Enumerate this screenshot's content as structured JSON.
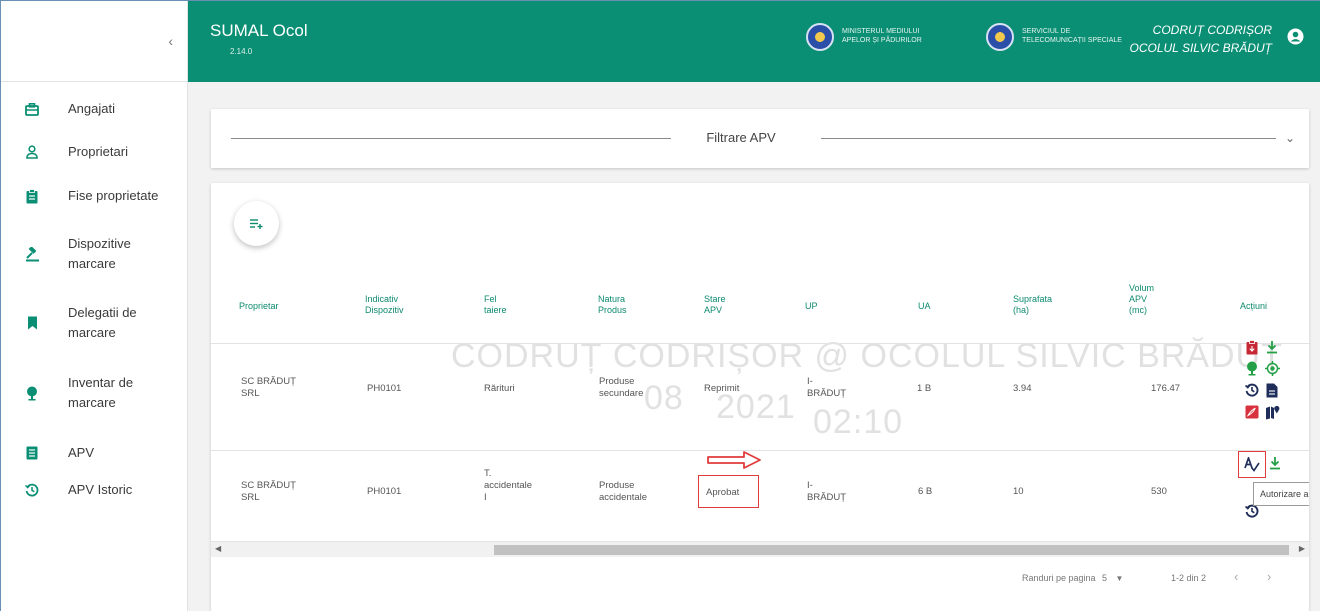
{
  "sidebar": {
    "collapse_icon": "chevron-left-icon",
    "items": [
      {
        "label": "Angajati",
        "icon": "briefcase-icon"
      },
      {
        "label": "Proprietari",
        "icon": "person-icon"
      },
      {
        "label": "Fise proprietate",
        "icon": "clipboard-icon"
      },
      {
        "label": "Dispozitive\nmarcare",
        "icon": "gavel-icon"
      },
      {
        "label": "Delegatii de\nmarcare",
        "icon": "bookmark-icon"
      },
      {
        "label": "Inventar de\nmarcare",
        "icon": "tree-icon"
      },
      {
        "label": "APV",
        "icon": "document-icon"
      },
      {
        "label": "APV Istoric",
        "icon": "history-icon"
      }
    ]
  },
  "header": {
    "title": "SUMAL Ocol",
    "version": "2.14.0",
    "org1": "MINISTERUL MEDIULUI APELOR ȘI PĂDURILOR",
    "org2": "SERVICIUL DE TELECOMUNICAȚII SPECIALE",
    "user_name": "CODRUȚ CODRIȘOR",
    "user_unit": "OCOLUL SILVIC BRĂDUȚ",
    "brand_color": "#0a8f74"
  },
  "filter": {
    "title": "Filtrare APV"
  },
  "watermark": {
    "line1": "CODRUȚ CODRIȘOR @ OCOLUL SILVIC BRĂDUȚ",
    "date": "08",
    "year": "2021",
    "time": "02:10"
  },
  "table": {
    "headers": {
      "proprietar": "Proprietar",
      "indicativ": "Indicativ\nDispozitiv",
      "fel": "Fel\ntaiere",
      "natura": "Natura\nProdus",
      "stare": "Stare\nAPV",
      "up": "UP",
      "ua": "UA",
      "suprafata": "Suprafata\n(ha)",
      "volum": "Volum\nAPV\n(mc)",
      "actiuni": "Acțiuni"
    },
    "rows": [
      {
        "proprietar": "SC BRĂDUȚ\nSRL",
        "indicativ": "PH0101",
        "fel": "Rărituri",
        "natura": "Produse\nsecundare",
        "stare": "Reprimit",
        "up": "I-\nBRĂDUȚ",
        "ua": "1 B",
        "suprafata": "3.94",
        "volum": "176.47"
      },
      {
        "proprietar": "SC BRĂDUȚ\nSRL",
        "indicativ": "PH0101",
        "fel": "T.\naccidentale\nI",
        "natura": "Produse\naccidentale",
        "stare": "Aprobat",
        "up": "I-\nBRĂDUȚ",
        "ua": "6 B",
        "suprafata": "10",
        "volum": "530"
      }
    ],
    "tooltip": "Autorizare apv"
  },
  "pagination": {
    "rows_label": "Randuri pe pagina",
    "rows_value": "5",
    "range": "1-2 din 2"
  },
  "colors": {
    "accent": "#0d8a6f",
    "danger": "#c62835",
    "green": "#23a046",
    "navy": "#1f2d5a",
    "highlight": "#e03c3c"
  }
}
